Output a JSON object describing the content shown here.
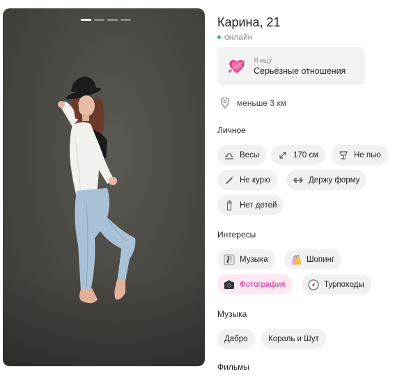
{
  "profile": {
    "name_age": "Карина, 21",
    "status": "онлайн",
    "seeking": {
      "label": "Я ищу",
      "value": "Серьёзные отношения",
      "icon": "heart-arrow-icon"
    },
    "distance": "меньше 3 км"
  },
  "photo": {
    "slides_total": 4,
    "active_slide": 1
  },
  "sections": {
    "personal": "Личное",
    "interests": "Интересы",
    "music": "Музыка",
    "films": "Фильмы"
  },
  "personal_chips": [
    {
      "label": "Весы",
      "icon": "libra-icon"
    },
    {
      "label": "170 см",
      "icon": "height-icon"
    },
    {
      "label": "Не пью",
      "icon": "glass-icon"
    },
    {
      "label": "Не курю",
      "icon": "no-smoking-icon"
    },
    {
      "label": "Держу форму",
      "icon": "dumbbell-icon"
    },
    {
      "label": "Нет детей",
      "icon": "baby-bottle-icon"
    }
  ],
  "interest_chips": [
    {
      "label": "Музыка",
      "icon": "music-icon"
    },
    {
      "label": "Шопинг",
      "icon": "shopping-icon"
    },
    {
      "label": "Фотография",
      "icon": "camera-icon",
      "selected": true
    },
    {
      "label": "Турпоходы",
      "icon": "compass-icon"
    }
  ],
  "music_chips": [
    {
      "label": "Дабро"
    },
    {
      "label": "Король и Шут"
    }
  ],
  "colors": {
    "accent_pink": "#d6329b",
    "online_green": "#3bb85a",
    "chip_bg": "#f1f1f4"
  }
}
